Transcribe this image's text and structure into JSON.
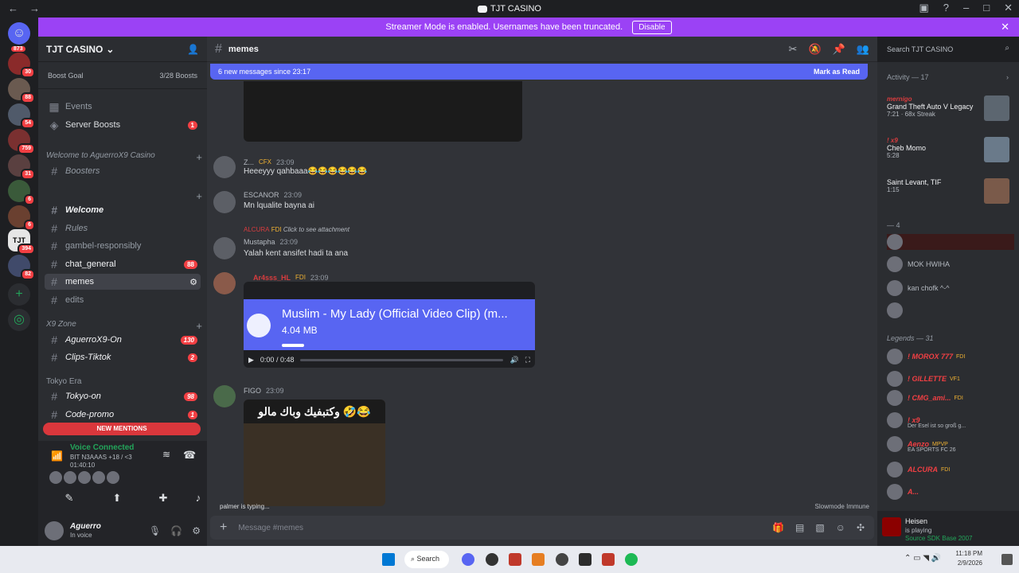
{
  "window": {
    "title": "TJT CASINO"
  },
  "banner": {
    "text": "Streamer Mode is enabled. Usernames have been truncated.",
    "button": "Disable"
  },
  "rail": {
    "badges": [
      "873",
      "30",
      "88",
      "54",
      "759",
      "31",
      "6",
      "6",
      "394",
      "82"
    ],
    "selected_label": "TJT"
  },
  "server": {
    "name": "TJT CASINO",
    "boost_goal": "Boost Goal",
    "boost_count": "3/28 Boosts",
    "events": "Events",
    "server_boosts": "Server Boosts",
    "server_boosts_badge": "1",
    "categories": {
      "welcome": "Welcome to AguerroX9 Casino",
      "x9zone": "X9 Zone",
      "tokyo": "Tokyo Era"
    },
    "channels": {
      "boosters": "Boosters",
      "welcome": "Welcome",
      "rules": "Rules",
      "gamble": "gambel-responsibly",
      "chat_general": "chat_general",
      "chat_general_badge": "88",
      "memes": "memes",
      "edits": "edits",
      "aguerro": "AguerroX9-On",
      "aguerro_badge": "130",
      "clips": "Clips-Tiktok",
      "clips_badge": "2",
      "tokyo_on": "Tokyo-on",
      "tokyo_on_badge": "98",
      "code_promo": "Code-promo",
      "code_promo_badge": "1"
    },
    "new_mentions": "NEW MENTIONS"
  },
  "voice": {
    "status": "Voice Connected",
    "channel": "BIT N3AAAS +18 / <3",
    "time": "01:40:10"
  },
  "user": {
    "name": "Aguerro",
    "status": "In voice"
  },
  "channel": {
    "name": "memes",
    "new_messages": "6 new messages since 23:17",
    "mark_read": "Mark as Read",
    "search_placeholder": "Search TJT CASINO",
    "input_placeholder": "Message #memes",
    "typing": "palmer is typing...",
    "slowmode": "Slowmode Immune"
  },
  "messages": [
    {
      "author": "Z...",
      "tag": "CFX",
      "time": "23:09",
      "text": "Heeeyyy qahbaaa😂😂😂😂😂😂"
    },
    {
      "author": "ESCANOR",
      "time": "23:09",
      "text": "Mn lqualite bayna ai"
    },
    {
      "reply_author": "ALCURA",
      "reply_tag": "FDI",
      "reply_text": "Click to see attachment",
      "author": "Mustapha",
      "time": "23:09",
      "text": "Yalah kent ansifet hadi ta ana"
    },
    {
      "author": "Ar4sss_HL",
      "tag": "FDI",
      "time": "23:09"
    },
    {
      "author": "FIGO",
      "time": "23:09"
    }
  ],
  "video": {
    "title": "Muslim - My Lady (Official Video Clip) (m...",
    "size": "4.04 MB",
    "time": "0:00 / 0:48"
  },
  "image_caption": "وكتبفيك وباك مالو 🤣😂",
  "activity": {
    "header": "Activity — 17",
    "items": [
      {
        "who": "mernigo",
        "what": "Grand Theft Auto V Legacy",
        "sub": "7:21 · 68x Streak"
      },
      {
        "who": "! x9",
        "what": "Cheb Momo",
        "sub": "5:28"
      },
      {
        "who": "",
        "what": "Saint Levant, TIF",
        "sub": "1:15"
      }
    ]
  },
  "members": {
    "group4": "— 4",
    "group4_items": [
      "",
      "MOK HWIHA",
      "kan chofk ^-^",
      ""
    ],
    "legends": "Legends — 31",
    "legends_items": [
      {
        "name": "! MOROX 777",
        "tag": "FDI"
      },
      {
        "name": "! GILLETTE",
        "tag": "VF1"
      },
      {
        "name": "! CMG_ami...",
        "tag": "FDI"
      },
      {
        "name": "! x9",
        "tag": "",
        "status": "Der Esel ist so groß g..."
      },
      {
        "name": "Aenzo",
        "tag": "MPVP",
        "status": "EA SPORTS FC 26"
      },
      {
        "name": "ALCURA",
        "tag": "FDI"
      },
      {
        "name": "A...",
        "tag": ""
      }
    ]
  },
  "now_playing": {
    "name": "Heisen",
    "status": "is playing",
    "game": "Source SDK Base 2007"
  },
  "taskbar": {
    "search": "Search",
    "time": "11:18 PM",
    "date": "2/9/2026"
  }
}
